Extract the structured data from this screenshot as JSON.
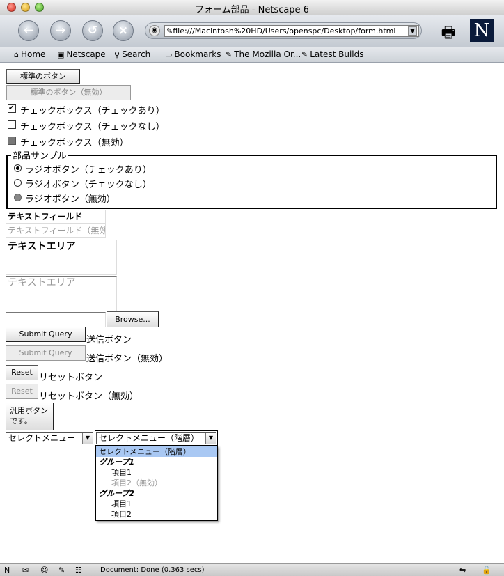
{
  "window": {
    "title": "フォーム部品 - Netscape 6"
  },
  "navbar": {
    "back_icon": "back-arrow-icon",
    "forward_icon": "forward-arrow-icon",
    "reload_icon": "reload-icon",
    "stop_icon": "stop-icon",
    "url": "file:///Macintosh%20HD/Users/openspc/Desktop/form.html"
  },
  "personal_toolbar": {
    "items": [
      "Home",
      "Netscape",
      "Search",
      "Bookmarks",
      "The Mozilla Or...",
      "Latest Builds"
    ]
  },
  "form": {
    "button_label": "標準のボタン",
    "button_disabled_label": "標準のボタン（無効）",
    "checkbox_checked_label": "チェックボックス（チェックあり）",
    "checkbox_unchecked_label": "チェックボックス（チェックなし）",
    "checkbox_disabled_label": "チェックボックス（無効）",
    "fieldset_legend": "部品サンプル",
    "radio_checked_label": "ラジオボタン（チェックあり）",
    "radio_unchecked_label": "ラジオボタン（チェックなし）",
    "radio_disabled_label": "ラジオボタン（無効）",
    "textfield_value": "テキストフィールド",
    "textfield_disabled_value": "テキストフィールド（無効）",
    "textarea_value": "テキストエリア",
    "textarea_disabled_value": "テキストエリア",
    "browse_label": "Browse...",
    "submit_label": "Submit Query",
    "submit_caption": "送信ボタン",
    "submit_disabled_label": "Submit Query",
    "submit_disabled_caption": "送信ボタン（無効）",
    "reset_label": "Reset",
    "reset_caption": "リセットボタン",
    "reset_disabled_label": "Reset",
    "reset_disabled_caption": "リセットボタン（無効）",
    "generic_button_line1": "汎用ボタン",
    "generic_button_line2": "です。",
    "select_value": "セレクトメニュー",
    "select_hier_value": "セレクトメニュー（階層）"
  },
  "dropdown": {
    "highlighted": "セレクトメニュー（階層）",
    "group1": "グループ1",
    "g1_item1": "項目1",
    "g1_item2_disabled": "項目2（無効）",
    "group2": "グループ2",
    "g2_item1": "項目1",
    "g2_item2": "項目2"
  },
  "statusbar": {
    "text": "Document: Done (0.363 secs)"
  }
}
